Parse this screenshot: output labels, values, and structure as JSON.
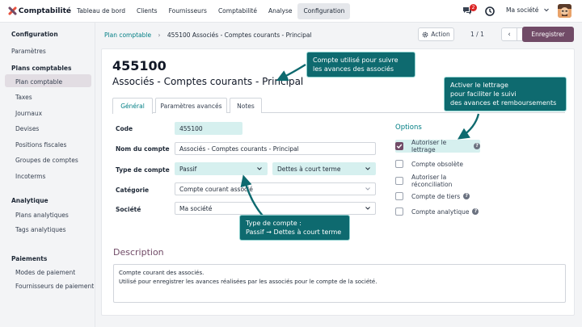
{
  "app": {
    "name": "Comptabilité"
  },
  "topnav": {
    "items": [
      "Tableau de bord",
      "Clients",
      "Fournisseurs",
      "Comptabilité",
      "Analyse",
      "Configuration"
    ],
    "active_index": 5,
    "notification_count": "2",
    "company": "Ma société"
  },
  "sidebar": {
    "sections": [
      {
        "title": "Configuration",
        "items": [
          "Paramètres"
        ]
      },
      {
        "title": "Plans comptables",
        "items": [
          "Plan comptable",
          "Taxes",
          "Journaux",
          "Devises",
          "Positions fiscales",
          "Groupes de comptes",
          "Incoterms"
        ]
      },
      {
        "title": "Analytique",
        "items": [
          "Plans analytiques",
          "Tags analytiques"
        ]
      },
      {
        "title": "Paiements",
        "items": [
          "Modes de paiement",
          "Fournisseurs de paiement"
        ]
      }
    ],
    "active_item": "Plan comptable"
  },
  "breadcrumb": {
    "parent": "Plan comptable",
    "current": "455100 Associés - Comptes courants - Principal"
  },
  "controls": {
    "action_label": "Action",
    "pager": "1 / 1",
    "save_label": "Enregistrer"
  },
  "record": {
    "code": "455100",
    "name": "Associés - Comptes courants - Principal"
  },
  "tabs": [
    "Général",
    "Paramètres avancés",
    "Notes"
  ],
  "active_tab": "Général",
  "form": {
    "code_label": "Code",
    "code_value": "455100",
    "name_label": "Nom du compte",
    "name_value": "Associés - Comptes courants - Principal",
    "type_label": "Type de compte",
    "type_value": "Passif",
    "subtype_value": "Dettes à court terme",
    "category_label": "Catégorie",
    "category_value": "Compte courant associé",
    "company_label": "Société",
    "company_value": "Ma société"
  },
  "options": {
    "title": "Options",
    "items": [
      {
        "label": "Autoriser le lettrage",
        "checked": true,
        "help": true
      },
      {
        "label": "Compte obsolète",
        "checked": false,
        "help": false
      },
      {
        "label": "Autoriser la réconciliation",
        "checked": false,
        "help": false
      },
      {
        "label": "Compte de tiers",
        "checked": false,
        "help": true
      },
      {
        "label": "Compte analytique",
        "checked": false,
        "help": true
      }
    ]
  },
  "description": {
    "title": "Description",
    "line1": "Compte courant des associés.",
    "line2": "Utilisé pour enregistrer les avances réalisées par les associés pour le compte de la société."
  },
  "callouts": {
    "account": {
      "line1": "Compte utilisé pour suivre",
      "line2": "les avances des associés"
    },
    "lettrage": {
      "line1": "Activer le lettrage",
      "line2": "pour faciliter le suivi",
      "line3": "des avances et remboursements"
    },
    "type": {
      "line1": "Type de compte :",
      "line2": "Passif → Dettes à court terme"
    }
  },
  "colors": {
    "brand": "#714b67",
    "accent": "#017e84",
    "callout": "#0e6a6f"
  }
}
